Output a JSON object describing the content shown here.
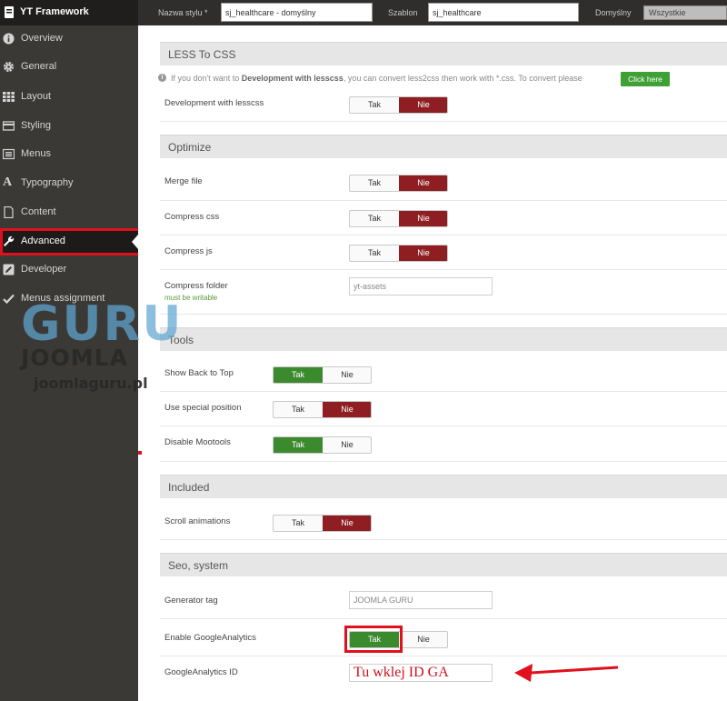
{
  "brand": {
    "title": "YT Framework"
  },
  "topbar": {
    "style_label": "Nazwa stylu *",
    "style_value": "sj_healthcare - domyślny",
    "template_label": "Szablon",
    "template_value": "sj_healthcare",
    "default_label": "Domyślny",
    "default_select": "Wszystkie"
  },
  "sidebar": {
    "items": [
      {
        "label": "Overview",
        "icon": "info-icon"
      },
      {
        "label": "General",
        "icon": "gear-icon"
      },
      {
        "label": "Layout",
        "icon": "grid-icon"
      },
      {
        "label": "Styling",
        "icon": "card-icon"
      },
      {
        "label": "Menus",
        "icon": "menu-icon"
      },
      {
        "label": "Typography",
        "icon": "font-icon"
      },
      {
        "label": "Content",
        "icon": "document-icon"
      },
      {
        "label": "Advanced",
        "icon": "wrench-icon",
        "active": true
      },
      {
        "label": "Developer",
        "icon": "pencil-icon"
      },
      {
        "label": "Menus assignment",
        "icon": "check-icon"
      }
    ]
  },
  "watermark": {
    "guru": "GURU",
    "joomla": "JOOMLA",
    "url": "joomlaguru.pl"
  },
  "toggle_labels": {
    "yes": "Tak",
    "no": "Nie"
  },
  "less": {
    "header": "LESS To CSS",
    "info_pre": "If you don't want to ",
    "info_bold": "Development with lesscss",
    "info_post": ", you can convert less2css then work with *.css. To convert please",
    "click_here": "Click here",
    "dev_label": "Development with lesscss",
    "dev_value": "Nie"
  },
  "optimize": {
    "header": "Optimize",
    "merge_label": "Merge file",
    "merge_value": "Nie",
    "css_label": "Compress css",
    "css_value": "Nie",
    "js_label": "Compress js",
    "js_value": "Nie",
    "folder_label": "Compress folder",
    "folder_note": "must be writable",
    "folder_value": "yt-assets"
  },
  "tools": {
    "header": "Tools",
    "backtop_label": "Show Back to Top",
    "backtop_value": "Tak",
    "special_label": "Use special position",
    "special_value": "Nie",
    "mootools_label": "Disable Mootools",
    "mootools_value": "Tak"
  },
  "included": {
    "header": "Included",
    "scroll_label": "Scroll animations",
    "scroll_value": "Nie"
  },
  "seo": {
    "header": "Seo, system",
    "generator_label": "Generator tag",
    "generator_value": "JOOMLA GURU",
    "ga_label": "Enable GoogleAnalytics",
    "ga_value": "Tak",
    "ga_id_label": "GoogleAnalytics ID",
    "ga_id_value": "Tu wklej ID GA"
  },
  "colors": {
    "accent_green": "#3b8a2e",
    "accent_red": "#8e1e22",
    "highlight": "#e0101c",
    "sidebar": "#3b3936"
  }
}
